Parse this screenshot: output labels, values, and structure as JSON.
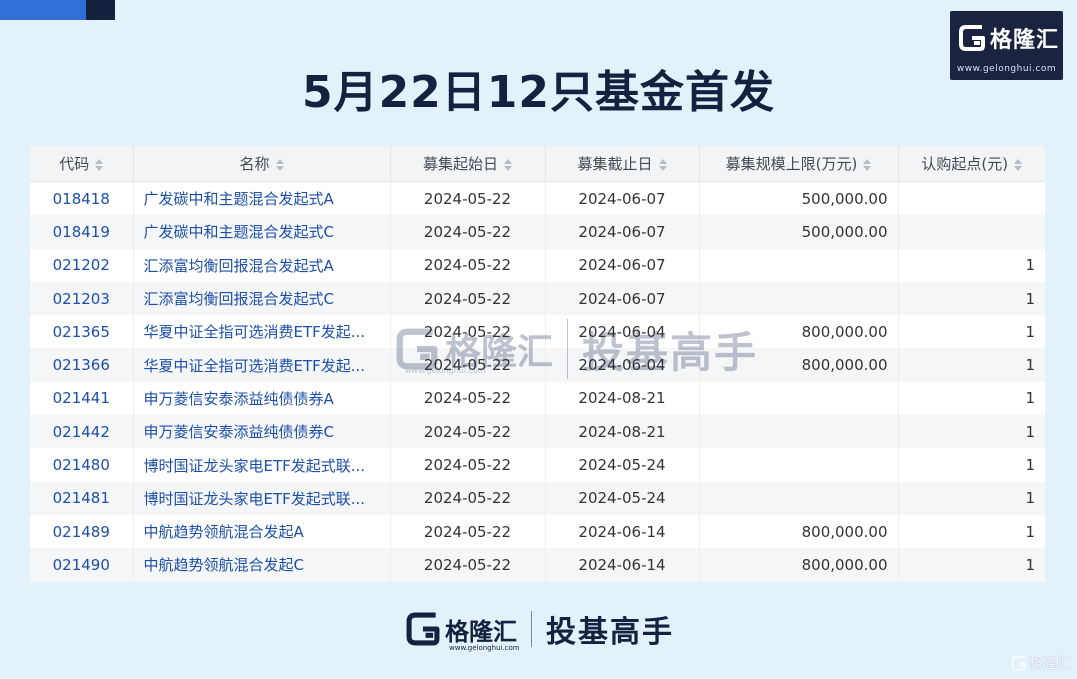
{
  "brand": {
    "name": "格隆汇",
    "url": "www.gelonghui.com",
    "slogan": "投基高手"
  },
  "title": "5月22日12只基金首发",
  "table": {
    "columns": [
      "代码",
      "名称",
      "募集起始日",
      "募集截止日",
      "募集规模上限(万元)",
      "认购起点(元)"
    ],
    "rows": [
      {
        "code": "018418",
        "name": "广发碳中和主题混合发起式A",
        "start": "2024-05-22",
        "end": "2024-06-07",
        "cap": "500,000.00",
        "min": ""
      },
      {
        "code": "018419",
        "name": "广发碳中和主题混合发起式C",
        "start": "2024-05-22",
        "end": "2024-06-07",
        "cap": "500,000.00",
        "min": ""
      },
      {
        "code": "021202",
        "name": "汇添富均衡回报混合发起式A",
        "start": "2024-05-22",
        "end": "2024-06-07",
        "cap": "",
        "min": "1"
      },
      {
        "code": "021203",
        "name": "汇添富均衡回报混合发起式C",
        "start": "2024-05-22",
        "end": "2024-06-07",
        "cap": "",
        "min": "1"
      },
      {
        "code": "021365",
        "name": "华夏中证全指可选消费ETF发起...",
        "start": "2024-05-22",
        "end": "2024-06-04",
        "cap": "800,000.00",
        "min": "1"
      },
      {
        "code": "021366",
        "name": "华夏中证全指可选消费ETF发起...",
        "start": "2024-05-22",
        "end": "2024-06-04",
        "cap": "800,000.00",
        "min": "1"
      },
      {
        "code": "021441",
        "name": "申万菱信安泰添益纯债债券A",
        "start": "2024-05-22",
        "end": "2024-08-21",
        "cap": "",
        "min": "1"
      },
      {
        "code": "021442",
        "name": "申万菱信安泰添益纯债债券C",
        "start": "2024-05-22",
        "end": "2024-08-21",
        "cap": "",
        "min": "1"
      },
      {
        "code": "021480",
        "name": "博时国证龙头家电ETF发起式联...",
        "start": "2024-05-22",
        "end": "2024-05-24",
        "cap": "",
        "min": "1"
      },
      {
        "code": "021481",
        "name": "博时国证龙头家电ETF发起式联...",
        "start": "2024-05-22",
        "end": "2024-05-24",
        "cap": "",
        "min": "1"
      },
      {
        "code": "021489",
        "name": "中航趋势领航混合发起A",
        "start": "2024-05-22",
        "end": "2024-06-14",
        "cap": "800,000.00",
        "min": "1"
      },
      {
        "code": "021490",
        "name": "中航趋势领航混合发起C",
        "start": "2024-05-22",
        "end": "2024-06-14",
        "cap": "800,000.00",
        "min": "1"
      }
    ]
  },
  "colors": {
    "background": "#e3f1fb",
    "title": "#15223f",
    "link": "#1c4fa8",
    "brand_dark": "#1a2440",
    "accent_blue": "#2f6fd6"
  },
  "icons": [
    "gelonghui-logo-icon",
    "sort-icon"
  ]
}
